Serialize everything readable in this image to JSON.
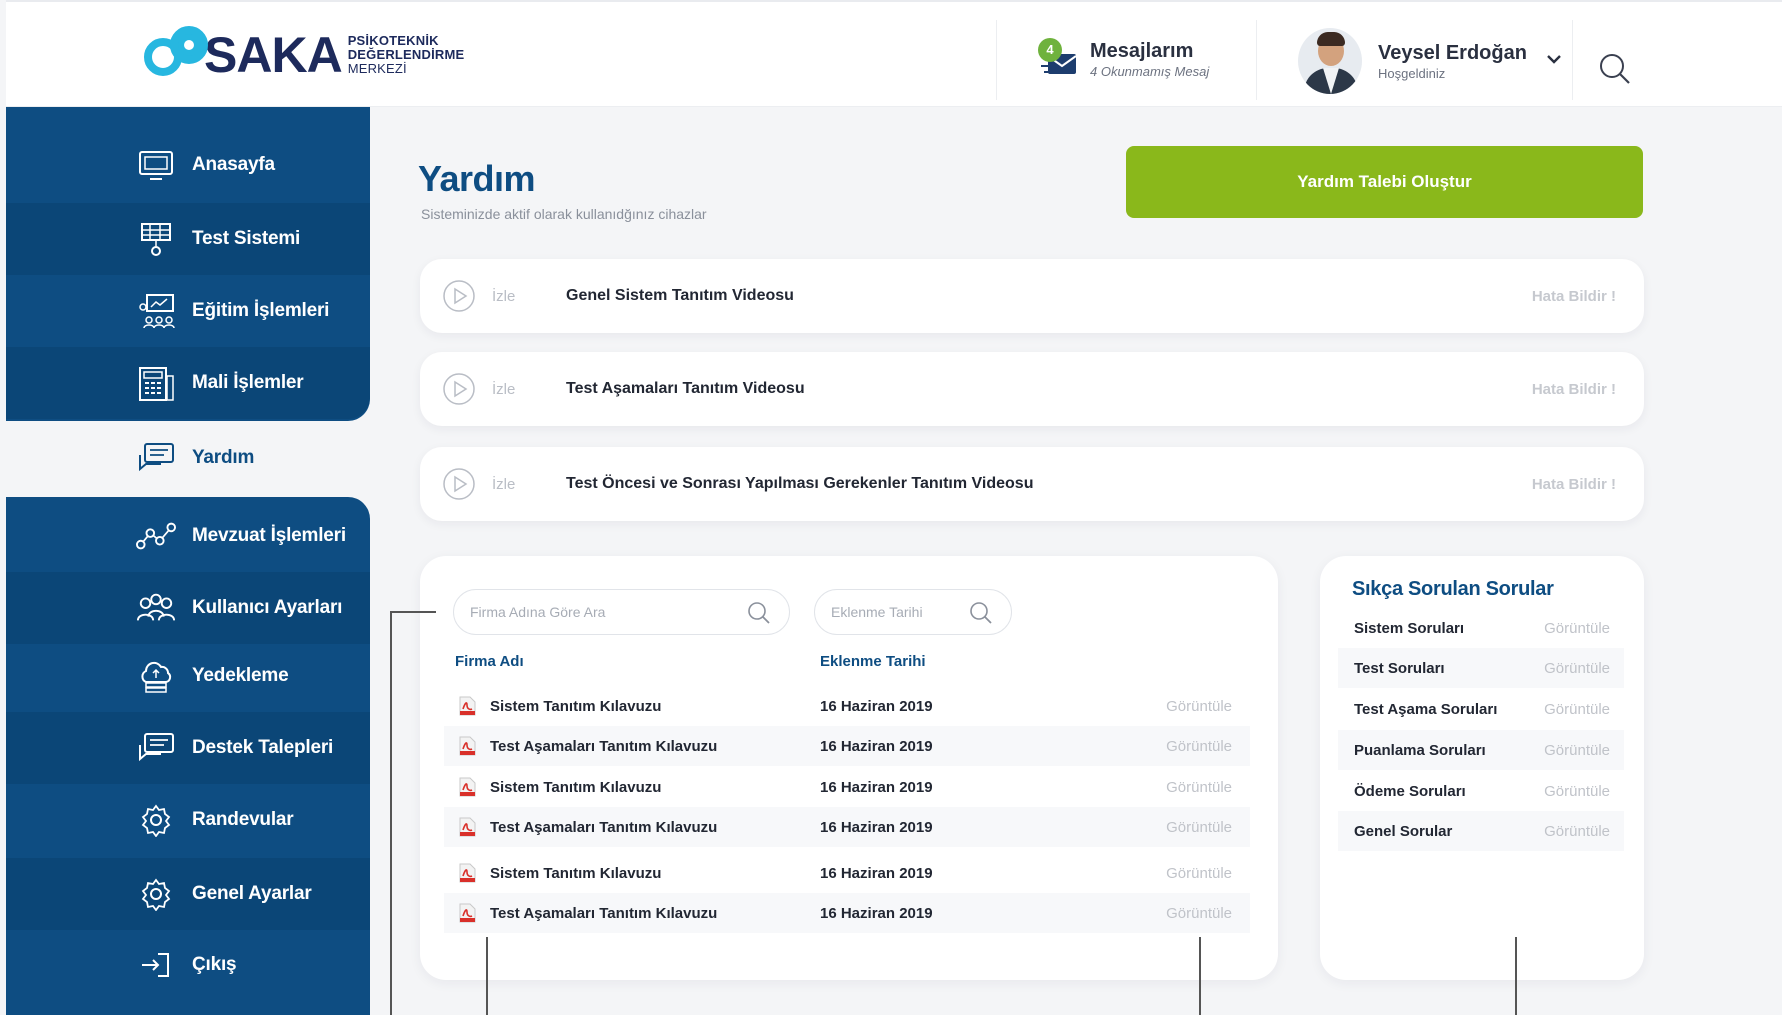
{
  "header": {
    "logo_text": "SAKA",
    "logo_sub_1": "PSİKOTEKNİK",
    "logo_sub_2": "DEĞERLENDİRME",
    "logo_sub_3": "MERKEZİ",
    "messages_badge": "4",
    "messages_title": "Mesajlarım",
    "messages_sub": "4 Okunmamış Mesaj",
    "user_name": "Veysel Erdoğan",
    "user_greeting": "Hoşgeldiniz"
  },
  "sidebar": {
    "items": [
      {
        "label": "Anasayfa",
        "icon": "monitor-icon"
      },
      {
        "label": "Test Sistemi",
        "icon": "network-icon"
      },
      {
        "label": "Eğitim İşlemleri",
        "icon": "classroom-icon"
      },
      {
        "label": "Mali İşlemler",
        "icon": "calculator-icon"
      },
      {
        "label": "Yardım",
        "icon": "chat-icon",
        "active": true
      },
      {
        "label": "Mevzuat İşlemleri",
        "icon": "graph-icon"
      },
      {
        "label": "Kullanıcı Ayarları",
        "icon": "users-icon"
      },
      {
        "label": "Yedekleme",
        "icon": "cloud-backup-icon"
      },
      {
        "label": "Destek Talepleri",
        "icon": "chat-icon"
      },
      {
        "label": "Randevular",
        "icon": "gear-icon"
      },
      {
        "label": "Genel Ayarlar",
        "icon": "gear-icon"
      },
      {
        "label": "Çıkış",
        "icon": "logout-icon"
      }
    ]
  },
  "page": {
    "title": "Yardım",
    "subtitle": "Sisteminizde aktif olarak kullanıdğınız cihazlar",
    "cta_label": "Yardım Talebi Oluştur"
  },
  "videos": [
    {
      "watch": "İzle",
      "title": "Genel Sistem Tanıtım Videosu",
      "report": "Hata Bildir !"
    },
    {
      "watch": "İzle",
      "title": "Test Aşamaları Tanıtım Videosu",
      "report": "Hata Bildir !"
    },
    {
      "watch": "İzle",
      "title": "Test Öncesi ve Sonrası Yapılması Gerekenler Tanıtım Videosu",
      "report": "Hata Bildir !"
    }
  ],
  "docs": {
    "search_placeholder": "Firma Adına Göre Ara",
    "date_placeholder": "Eklenme Tarihi",
    "col_name": "Firma Adı",
    "col_date": "Eklenme Tarihi",
    "rows": [
      {
        "name": "Sistem Tanıtım Kılavuzu",
        "date": "16 Haziran 2019",
        "view": "Görüntüle"
      },
      {
        "name": "Test Aşamaları Tanıtım Kılavuzu",
        "date": "16 Haziran 2019",
        "view": "Görüntüle"
      },
      {
        "name": "Sistem Tanıtım Kılavuzu",
        "date": "16 Haziran 2019",
        "view": "Görüntüle"
      },
      {
        "name": "Test Aşamaları Tanıtım Kılavuzu",
        "date": "16 Haziran 2019",
        "view": "Görüntüle"
      },
      {
        "name": "Sistem Tanıtım Kılavuzu",
        "date": "16 Haziran 2019",
        "view": "Görüntüle"
      },
      {
        "name": "Test Aşamaları Tanıtım Kılavuzu",
        "date": "16 Haziran 2019",
        "view": "Görüntüle"
      }
    ]
  },
  "faq": {
    "title": "Sıkça Sorulan Sorular",
    "rows": [
      {
        "label": "Sistem Soruları",
        "view": "Görüntüle"
      },
      {
        "label": "Test Soruları",
        "view": "Görüntüle"
      },
      {
        "label": "Test Aşama Soruları",
        "view": "Görüntüle"
      },
      {
        "label": "Puanlama Soruları",
        "view": "Görüntüle"
      },
      {
        "label": "Ödeme Soruları",
        "view": "Görüntüle"
      },
      {
        "label": "Genel Sorular",
        "view": "Görüntüle"
      }
    ]
  },
  "colors": {
    "brand_blue": "#0e4d82",
    "cta_green": "#8ab81b",
    "logo_cyan": "#27b7e0",
    "badge_green": "#6fb23d"
  }
}
